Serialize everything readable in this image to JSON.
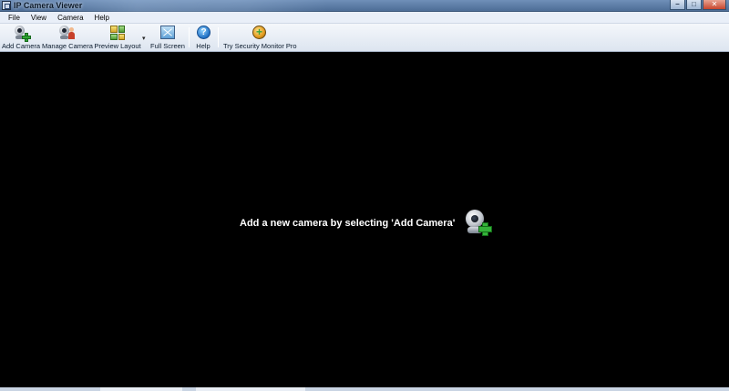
{
  "window": {
    "title": "IP Camera Viewer",
    "buttons": {
      "minimize": "–",
      "maximize": "□",
      "close": "✕"
    }
  },
  "menu": {
    "items": [
      "File",
      "View",
      "Camera",
      "Help"
    ]
  },
  "toolbar": {
    "buttons": [
      {
        "label": "Add Camera",
        "icon": "add-camera-icon"
      },
      {
        "label": "Manage Camera",
        "icon": "manage-camera-icon"
      },
      {
        "label": "Preview Layout",
        "icon": "preview-layout-icon"
      },
      {
        "label": "Full Screen",
        "icon": "full-screen-icon"
      },
      {
        "label": "Help",
        "icon": "help-icon"
      },
      {
        "label": "Try Security Monitor Pro",
        "icon": "security-monitor-pro-icon"
      }
    ],
    "help_glyph": "?"
  },
  "viewer": {
    "hint": "Add a new camera by selecting 'Add Camera'",
    "hint_icon": "add-camera-icon"
  },
  "colors": {
    "viewer_background": "#000000",
    "hint_text": "#ffffff",
    "toolbar_bg": "#e9eff8",
    "accent_green": "#35b23a"
  }
}
